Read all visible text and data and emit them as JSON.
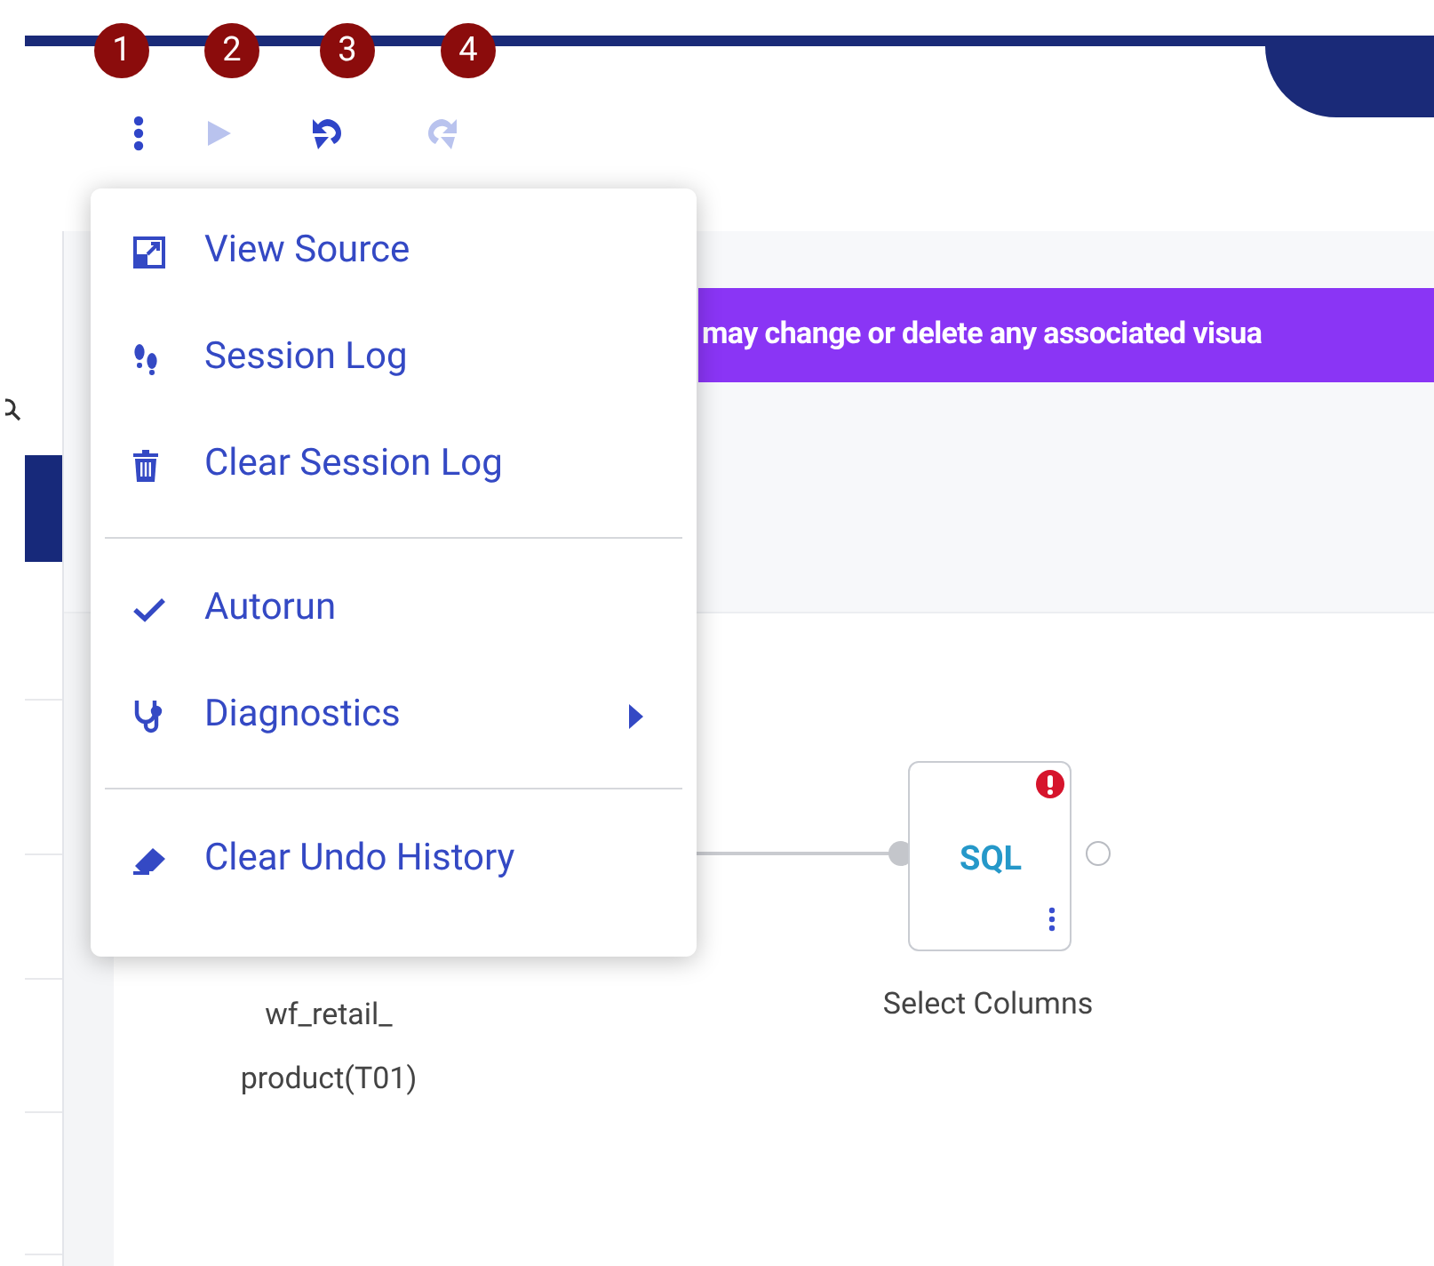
{
  "callouts": [
    "1",
    "2",
    "3",
    "4"
  ],
  "toolbar": [
    {
      "kind": "more",
      "disabled": false
    },
    {
      "kind": "run",
      "disabled": true
    },
    {
      "kind": "undo",
      "disabled": false
    },
    {
      "kind": "redo",
      "disabled": true
    }
  ],
  "banner": {
    "text": "may change or delete any associated visua"
  },
  "menu": {
    "sections": [
      [
        {
          "kind": "view-source",
          "label": "View Source"
        },
        {
          "kind": "session-log",
          "label": "Session Log"
        },
        {
          "kind": "clear-log",
          "label": "Clear Session Log"
        }
      ],
      [
        {
          "kind": "toggle",
          "label": "Autorun",
          "checked": true
        },
        {
          "kind": "submenu",
          "label": "Diagnostics"
        }
      ],
      [
        {
          "kind": "clear-undo",
          "label": "Clear Undo History"
        }
      ]
    ]
  },
  "flow": {
    "source": {
      "label": "wf_retail_product(T01)"
    },
    "target": {
      "badge": "SQL",
      "label": "Select Columns",
      "error": true
    }
  }
}
